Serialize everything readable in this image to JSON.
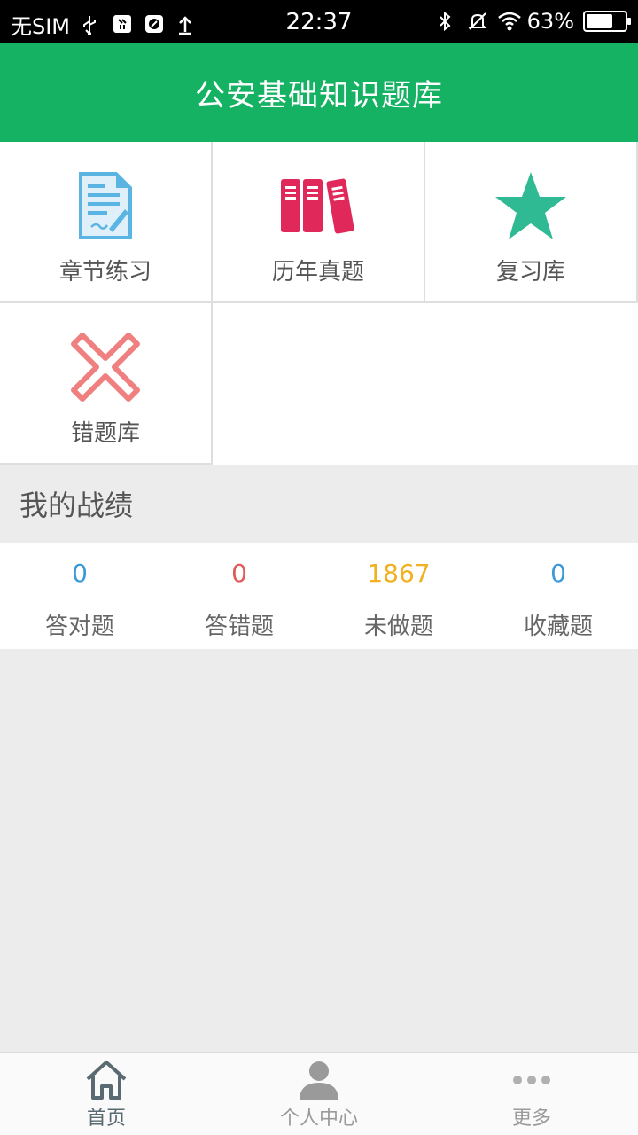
{
  "status_bar": {
    "carrier": "无SIM",
    "time": "22:37",
    "battery": "63%",
    "battery_level": 0.63
  },
  "header": {
    "title": "公安基础知识题库"
  },
  "grid": {
    "items": [
      {
        "label": "章节练习",
        "icon": "document-pen-icon"
      },
      {
        "label": "历年真题",
        "icon": "binders-icon"
      },
      {
        "label": "复习库",
        "icon": "star-icon"
      },
      {
        "label": "错题库",
        "icon": "x-icon"
      }
    ]
  },
  "section": {
    "title": "我的战绩"
  },
  "stats": [
    {
      "value": "0",
      "label": "答对题",
      "color": "#3a9ad9"
    },
    {
      "value": "0",
      "label": "答错题",
      "color": "#e05a5a"
    },
    {
      "value": "1867",
      "label": "未做题",
      "color": "#f0b020"
    },
    {
      "value": "0",
      "label": "收藏题",
      "color": "#3a9ad9"
    }
  ],
  "tabbar": {
    "items": [
      {
        "label": "首页",
        "icon": "home-icon",
        "active": true
      },
      {
        "label": "个人中心",
        "icon": "user-icon",
        "active": false
      },
      {
        "label": "更多",
        "icon": "more-dots-icon",
        "active": false
      }
    ]
  },
  "colors": {
    "brand": "#16b264",
    "active_tab": "#5a6a72",
    "inactive_tab": "#9a9a9a"
  }
}
